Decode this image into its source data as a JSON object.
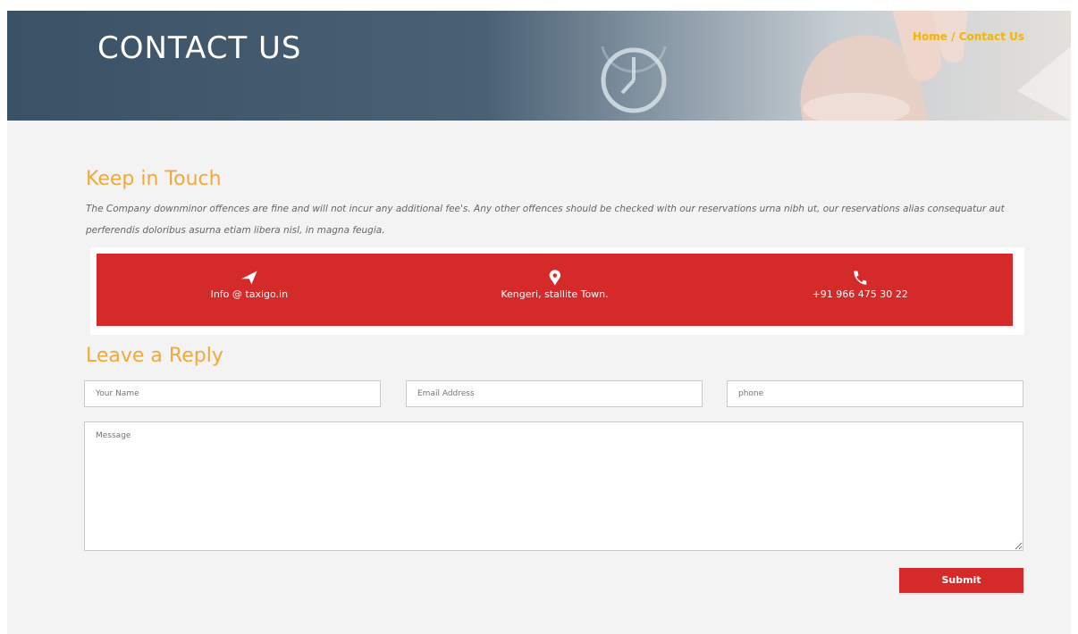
{
  "banner": {
    "title": "CONTACT US",
    "breadcrumb": {
      "home": "Home",
      "separator": " / ",
      "current": "Contact Us"
    }
  },
  "keep_in_touch": {
    "title": "Keep in Touch",
    "text": "The Company downminor offences are fine and will not incur any additional fee's. Any other offences should be checked with our reservations urna nibh ut, our reservations alias consequatur aut perferendis doloribus asurna etiam libera nisl, in magna feugia.",
    "contacts": [
      {
        "icon": "paper-plane-icon",
        "text": "Info @ taxigo.in"
      },
      {
        "icon": "map-pin-icon",
        "text": "Kengeri, stallite Town."
      },
      {
        "icon": "phone-icon",
        "text": "+91 966 475 30 22"
      }
    ]
  },
  "reply": {
    "title": "Leave a Reply",
    "name_placeholder": "Your Name",
    "email_placeholder": "Email Address",
    "phone_placeholder": "phone",
    "message_placeholder": "Message",
    "submit_label": "Submit"
  },
  "colors": {
    "accent": "#d52a2a",
    "heading": "#f0a93a",
    "breadcrumb": "#f5b400",
    "banner": "#3b5266"
  }
}
